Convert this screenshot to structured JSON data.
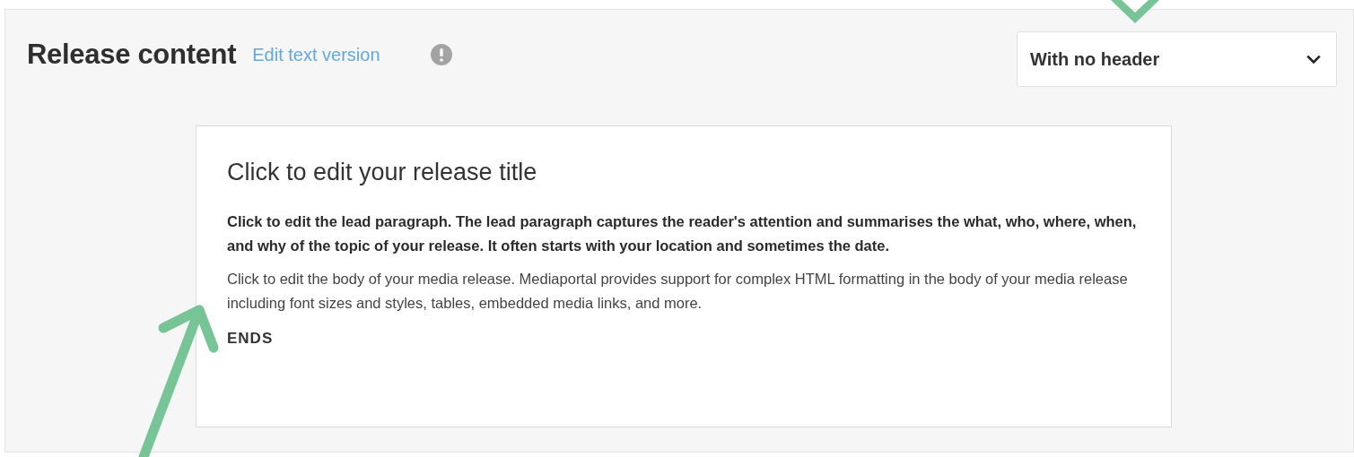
{
  "section": {
    "title": "Release content",
    "link": "Edit text version"
  },
  "header_select": {
    "value": "With no header"
  },
  "release": {
    "title": "Click to edit your release title",
    "lead": "Click to edit the lead paragraph. The lead paragraph captures the reader's attention and summarises the what, who, where, when, and why of the topic of your release. It often starts with your location and sometimes the date.",
    "body": "Click to edit the body of your media release. Mediaportal provides support for complex HTML formatting in the body of your media release including font sizes and styles, tables, embedded media links, and more.",
    "end_mark": "ENDS"
  }
}
